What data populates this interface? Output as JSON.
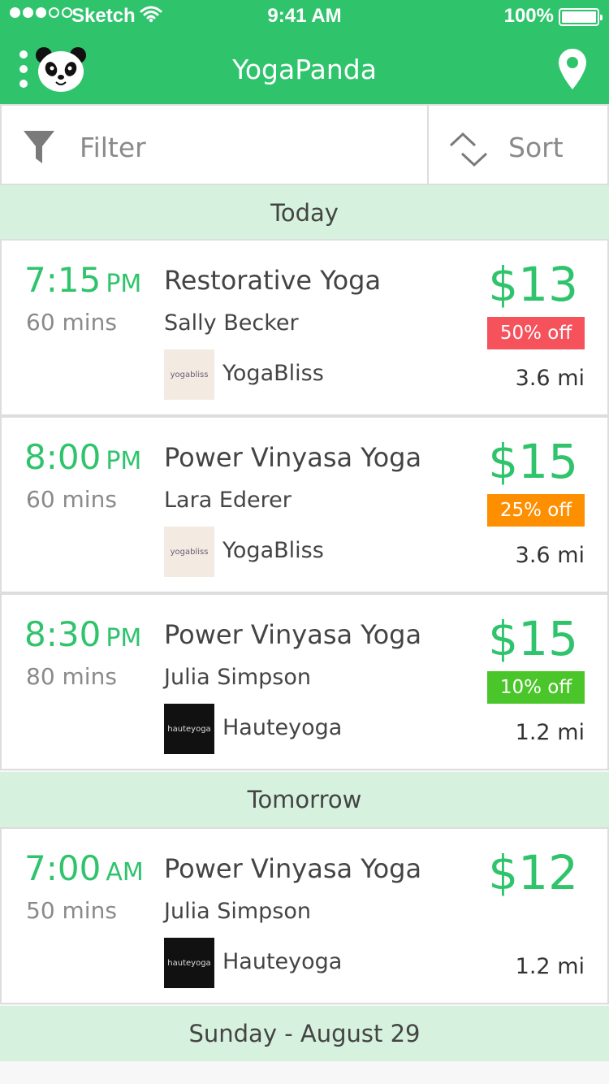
{
  "status_bar": {
    "carrier": "Sketch",
    "time": "9:41 AM",
    "battery": "100%",
    "signal_bars_filled": 3,
    "signal_bars_total": 5,
    "battery_level": 1.0
  },
  "nav": {
    "title": "YogaPanda",
    "menu_icon": "menu-dots-icon",
    "logo_icon": "panda-icon",
    "location_icon": "location-pin-icon"
  },
  "toolbar": {
    "filter_label": "Filter",
    "filter_icon": "funnel-icon",
    "sort_label": "Sort",
    "sort_icon": "sort-chevrons-icon"
  },
  "colors": {
    "brand": "#2fc46c",
    "section_bg": "#d6f1de",
    "badge_50": "#f5525c",
    "badge_25": "#fe8f00",
    "badge_10": "#4bc62a"
  },
  "sections": [
    {
      "label": "Today",
      "classes": [
        {
          "time": "7:15",
          "ampm": "PM",
          "duration": "60 mins",
          "name": "Restorative Yoga",
          "instructor": "Sally Becker",
          "studio": "YogaBliss",
          "studio_logo": "yogabliss",
          "price": "$13",
          "discount": "50% off",
          "distance": "3.6 mi"
        },
        {
          "time": "8:00",
          "ampm": "PM",
          "duration": "60 mins",
          "name": "Power Vinyasa Yoga",
          "instructor": "Lara Ederer",
          "studio": "YogaBliss",
          "studio_logo": "yogabliss",
          "price": "$15",
          "discount": "25% off",
          "distance": "3.6 mi"
        },
        {
          "time": "8:30",
          "ampm": "PM",
          "duration": "80 mins",
          "name": "Power Vinyasa Yoga",
          "instructor": "Julia Simpson",
          "studio": "Hauteyoga",
          "studio_logo": "hauteyoga",
          "price": "$15",
          "discount": "10% off",
          "distance": "1.2 mi"
        }
      ]
    },
    {
      "label": "Tomorrow",
      "classes": [
        {
          "time": "7:00",
          "ampm": "AM",
          "duration": "50 mins",
          "name": "Power Vinyasa Yoga",
          "instructor": "Julia Simpson",
          "studio": "Hauteyoga",
          "studio_logo": "hauteyoga",
          "price": "$12",
          "discount": "",
          "distance": "1.2 mi"
        }
      ]
    },
    {
      "label": "Sunday - August 29",
      "classes": []
    }
  ]
}
